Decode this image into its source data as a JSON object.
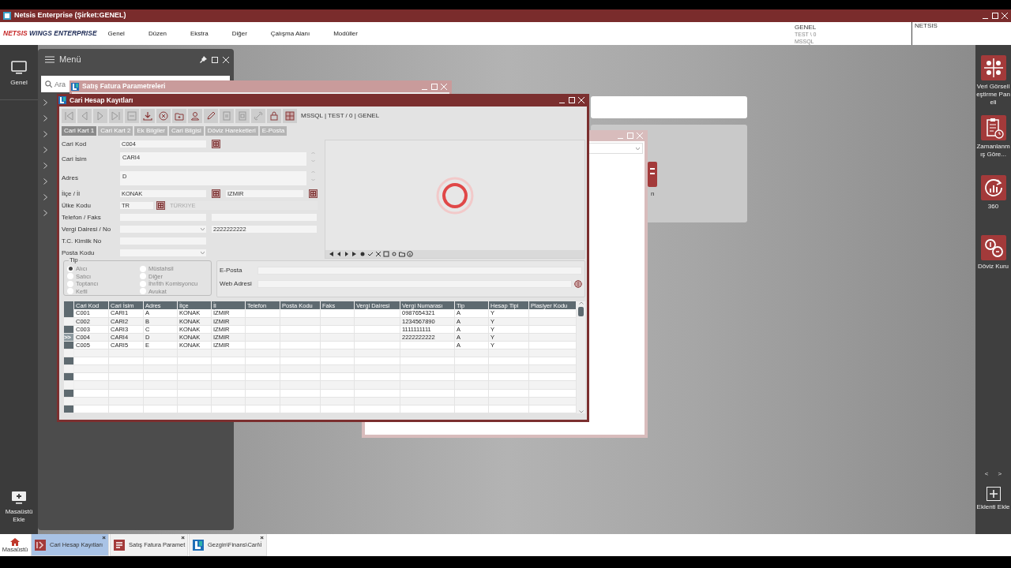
{
  "app": {
    "title": "Netsis Enterprise (Şirket:GENEL)"
  },
  "logo": {
    "brand": "NETSIS",
    "product": "WINGS ENTERPRISE"
  },
  "menu": [
    "Genel",
    "Düzen",
    "Ekstra",
    "Diğer",
    "Çalışma Alanı",
    "Modüller"
  ],
  "session": {
    "company": "GENEL",
    "period": "TEST \\ 0",
    "database": "MSSQL",
    "user": "NETSIS"
  },
  "left_rail": {
    "items": [
      {
        "label": "Genel"
      }
    ],
    "add_desktop": "Masaüstü Ekle"
  },
  "menu_panel": {
    "title": "Menü",
    "search": {
      "placeholder": "Ara"
    },
    "tree": [
      {
        "expanded": false
      },
      {
        "expanded": false
      },
      {
        "expanded": false
      },
      {
        "expanded": false
      },
      {
        "expanded": false
      },
      {
        "expanded": false
      },
      {
        "expanded": false
      },
      {
        "expanded": false
      }
    ]
  },
  "right_rail": {
    "items": [
      {
        "kind": "dashboard",
        "label": "Veri Görselleştirme Paneli"
      },
      {
        "kind": "report",
        "label": "Zamanlanmış Göre..."
      },
      {
        "kind": "insight",
        "label": "360"
      },
      {
        "kind": "currency",
        "label": "Döviz Kuru"
      }
    ],
    "pager": [
      "<",
      ">"
    ],
    "add_plugin": "Eklenti Ekle"
  },
  "background": {
    "tile_label": "n",
    "window_title": "Satış Fatura Parametreleri"
  },
  "main_window": {
    "title": "Cari Hesap Kayıtları",
    "connection": "MSSQL | TEST / 0 | GENEL",
    "tabs": [
      {
        "label": "Cari Kart 1",
        "selected": true
      },
      {
        "label": "Cari Kart 2",
        "selected": false
      },
      {
        "label": "Ek Bilgiler",
        "selected": false
      },
      {
        "label": "Cari Bilgisi",
        "selected": false
      },
      {
        "label": "Döviz Hareketleri",
        "selected": false
      },
      {
        "label": "E-Posta",
        "selected": false
      }
    ],
    "fields": [
      {
        "label": "Cari Kod",
        "kind": "lookup",
        "value": "C004"
      },
      {
        "label": "Cari İsim",
        "kind": "memo",
        "value": "CARI4"
      },
      {
        "label": "Adres",
        "kind": "memo",
        "value": "D"
      },
      {
        "label": "İlçe / İl",
        "kind": "lookup_pair",
        "value": "KONAK",
        "value2": "IZMIR"
      },
      {
        "label": "Ülke Kodu",
        "kind": "lookup_desc",
        "value": "TR",
        "value2": "TÜRKIYE"
      },
      {
        "label": "Telefon / Faks",
        "kind": "pair"
      },
      {
        "label": "Vergi Dairesi / No",
        "kind": "select_pair",
        "value2": "2222222222"
      },
      {
        "label": "T.C. Kimlik No",
        "kind": "text"
      },
      {
        "label": "Posta Kodu",
        "kind": "select"
      }
    ],
    "tip": {
      "label": "Tip",
      "options": [
        {
          "label": "Alıcı",
          "selected": true
        },
        {
          "label": "Satıcı",
          "selected": false
        },
        {
          "label": "Toptancı",
          "selected": false
        },
        {
          "label": "Kefil",
          "selected": false
        },
        {
          "label": "Müstahsil",
          "selected": false
        },
        {
          "label": "Diğer",
          "selected": false
        },
        {
          "label": "İhr/İth Komisyoncu",
          "selected": false
        },
        {
          "label": "Avukat",
          "selected": false
        }
      ]
    },
    "email": {
      "label": "E-Posta"
    },
    "web": {
      "label": "Web Adresi"
    },
    "table": {
      "row_indicator": ">>",
      "columns": [
        "Cari Kod",
        "Cari İsim",
        "Adres",
        "İlçe",
        "İl",
        "Telefon",
        "Posta Kodu",
        "Faks",
        "Vergi Dairesi",
        "Vergi Numarası",
        "Tip",
        "Hesap Tipi",
        "Plasiyer Kodu"
      ],
      "rows": [
        {
          "current": false,
          "cells": [
            "C001",
            "CARI1",
            "A",
            "KONAK",
            "İZMIR",
            null,
            null,
            null,
            null,
            "0987654321",
            "A",
            "Y",
            null
          ]
        },
        {
          "current": false,
          "cells": [
            "C002",
            "CARI2",
            "B",
            "KONAK",
            "IZMIR",
            null,
            null,
            null,
            null,
            "1234567890",
            "A",
            "Y",
            null
          ]
        },
        {
          "current": false,
          "cells": [
            "C003",
            "CARI3",
            "C",
            "KONAK",
            "IZMIR",
            null,
            null,
            null,
            null,
            "1111111111",
            "A",
            "Y",
            null
          ]
        },
        {
          "current": true,
          "cells": [
            "C004",
            "CARI4",
            "D",
            "KONAK",
            "IZMIR",
            null,
            null,
            null,
            null,
            "2222222222",
            "A",
            "Y",
            null
          ]
        },
        {
          "current": false,
          "cells": [
            "C005",
            "CARI5",
            "E",
            "KONAK",
            "IZMIR",
            null,
            null,
            null,
            null,
            null,
            "A",
            "Y",
            null
          ]
        }
      ]
    }
  },
  "taskbar": {
    "home": "Masaüstü",
    "items": [
      {
        "kind": "records",
        "label": "Cari Hesap Kayıtları",
        "close": "×",
        "selected": true
      },
      {
        "kind": "params",
        "label": "Satış Fatura Paramet",
        "close": "×",
        "selected": false
      },
      {
        "kind": "explorer",
        "label": "Gezgin\\Finans\\Cari\\İ",
        "close": "×",
        "selected": false
      }
    ]
  }
}
